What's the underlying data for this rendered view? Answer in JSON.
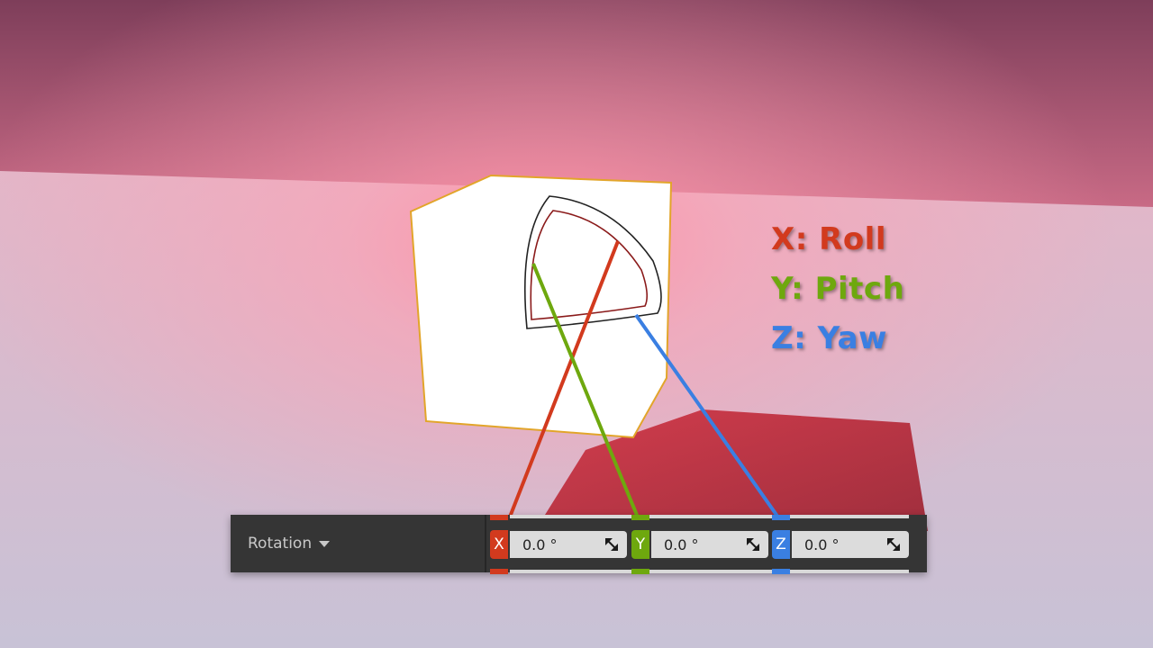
{
  "legend": {
    "x_label": "X: Roll",
    "y_label": "Y: Pitch",
    "z_label": "Z: Yaw"
  },
  "colors": {
    "x_axis": "#d23a1e",
    "y_axis": "#6ea80e",
    "z_axis": "#3a7fe2",
    "panel_bg": "#353535",
    "field_bg": "#dcdcdc",
    "cube_outline": "#e2a52a"
  },
  "rotation": {
    "label": "Rotation",
    "x": {
      "tag": "X",
      "value": "0.0 °"
    },
    "y": {
      "tag": "Y",
      "value": "0.0 °"
    },
    "z": {
      "tag": "Z",
      "value": "0.0 °"
    }
  },
  "icons": {
    "dropdown": "caret-down-icon",
    "spin": "spin-resize-icon",
    "gizmo": "rotation-gizmo-icon"
  }
}
